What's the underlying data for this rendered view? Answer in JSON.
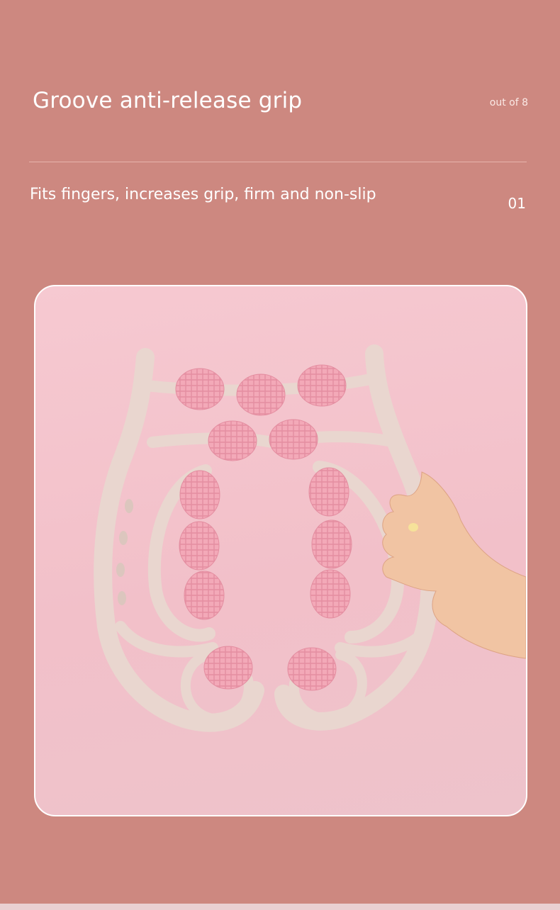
{
  "header": {
    "title": "Groove anti-release grip",
    "counter": "out of 8"
  },
  "feature": {
    "description": "Fits fingers, increases grip, firm and non-slip",
    "index": "01"
  },
  "colors": {
    "background": "#cd8880",
    "photo_background": "#f4c4cc",
    "device_body": "#e9d4cd",
    "roller": "#f3a7b7",
    "skin": "#f2c6a5"
  },
  "photo": {
    "subject": "massage-roller-product-photo"
  }
}
